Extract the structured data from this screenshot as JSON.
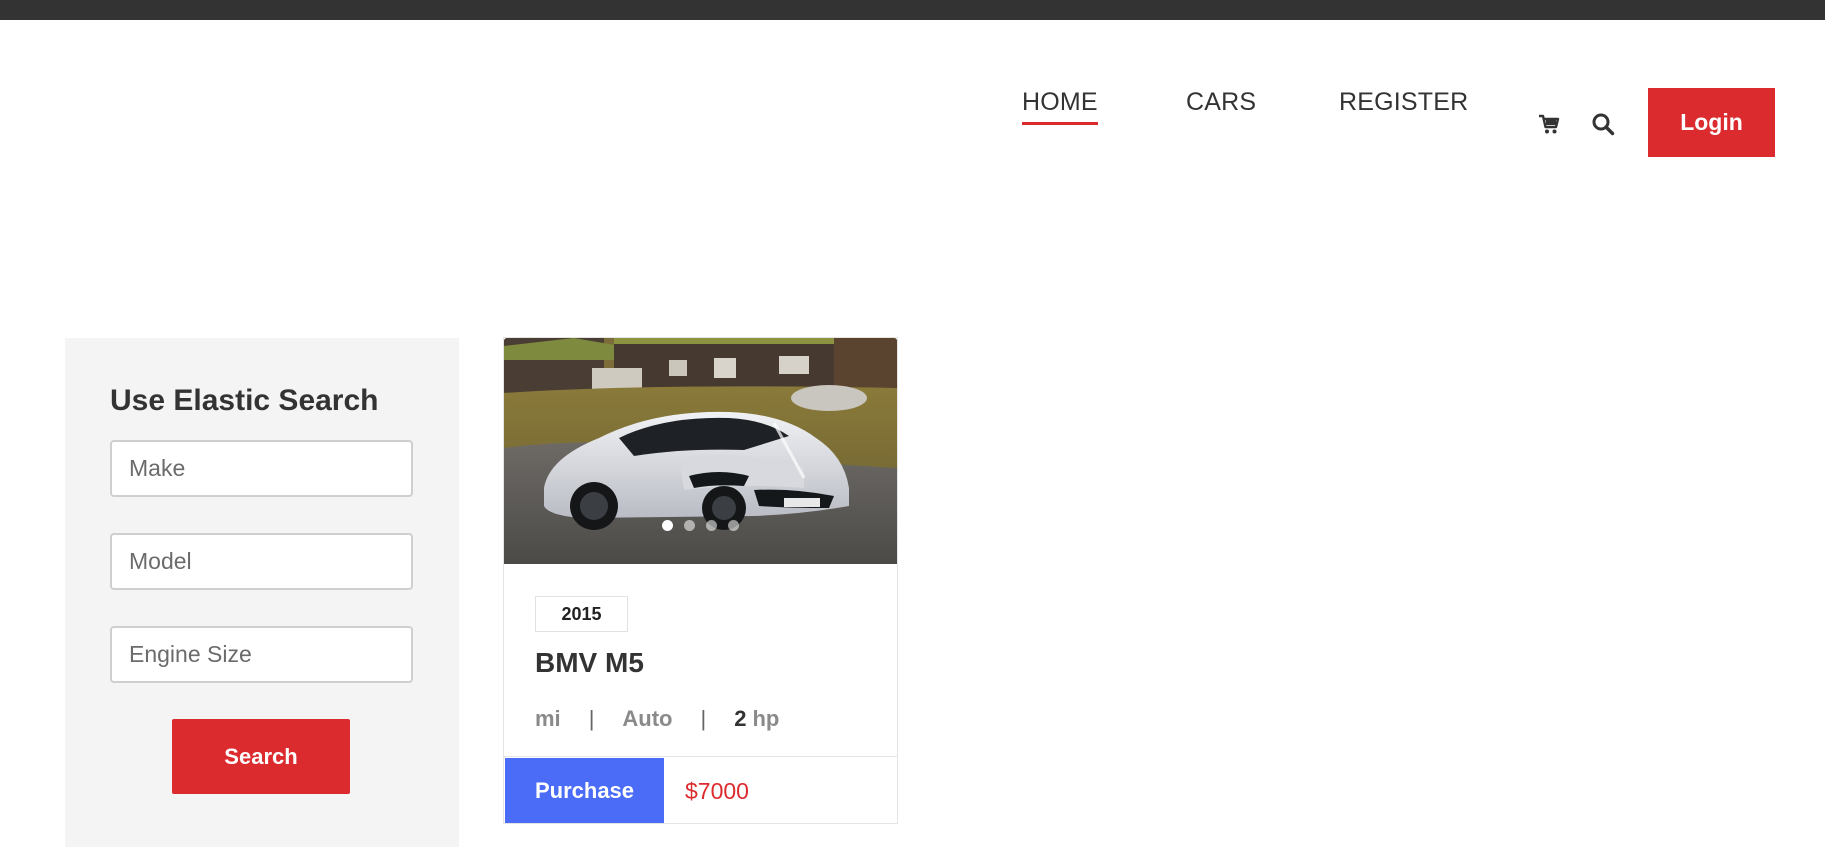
{
  "nav": {
    "items": [
      {
        "label": "HOME",
        "active": true
      },
      {
        "label": "CARS",
        "active": false
      },
      {
        "label": "REGISTER",
        "active": false
      }
    ],
    "icons": [
      "cart-icon",
      "search-icon"
    ],
    "login_label": "Login"
  },
  "sidebar": {
    "title": "Use Elastic Search",
    "make_placeholder": "Make",
    "model_placeholder": "Model",
    "engine_placeholder": "Engine Size",
    "search_label": "Search"
  },
  "car": {
    "year": "2015",
    "title": "BMV M5",
    "mileage_unit": "mi",
    "transmission": "Auto",
    "hp_value": "2",
    "hp_unit": "hp",
    "purchase_label": "Purchase",
    "price": "$7000",
    "carousel_slides": 4,
    "carousel_active": 1
  },
  "colors": {
    "accent_red": "#dc2b2e",
    "purchase_blue": "#4a6cf7",
    "topbar": "#333333",
    "sidebar_bg": "#f4f4f4"
  }
}
